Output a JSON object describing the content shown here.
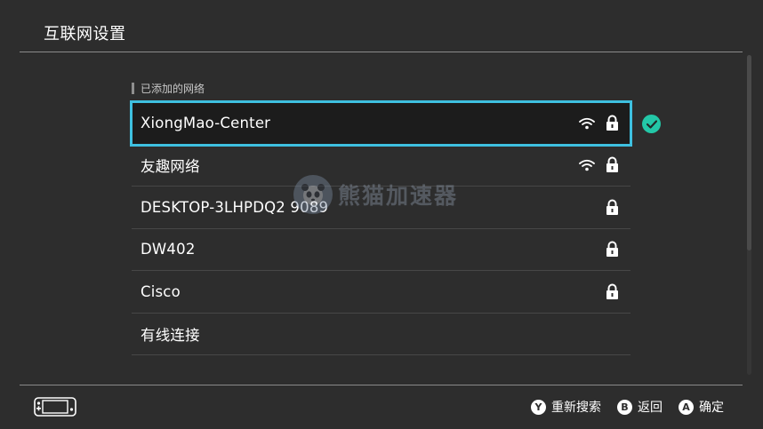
{
  "header": {
    "title": "互联网设置"
  },
  "section": {
    "label": "已添加的网络"
  },
  "networks": [
    {
      "name": "XiongMao-Center",
      "wifi": true,
      "lock": true,
      "selected": true,
      "connected": true
    },
    {
      "name": "友趣网络",
      "wifi": true,
      "lock": true,
      "selected": false,
      "connected": false
    },
    {
      "name": "DESKTOP-3LHPDQ2 9089",
      "wifi": false,
      "lock": true,
      "selected": false,
      "connected": false
    },
    {
      "name": "DW402",
      "wifi": false,
      "lock": true,
      "selected": false,
      "connected": false
    },
    {
      "name": "Cisco",
      "wifi": false,
      "lock": true,
      "selected": false,
      "connected": false
    },
    {
      "name": "有线连接",
      "wifi": false,
      "lock": false,
      "selected": false,
      "connected": false
    }
  ],
  "watermark": {
    "text": "熊猫加速器"
  },
  "footer": {
    "actions": [
      {
        "glyph": "Y",
        "label": "重新搜索"
      },
      {
        "glyph": "B",
        "label": "返回"
      },
      {
        "glyph": "A",
        "label": "确定"
      }
    ]
  },
  "colors": {
    "background": "#2d2d2d",
    "selection": "#3ec0e0",
    "connected": "#23c7a7"
  },
  "icons": {
    "wifi": "wifi-icon",
    "lock": "lock-icon",
    "connected": "check-circle-icon",
    "console": "handheld-console-icon"
  }
}
